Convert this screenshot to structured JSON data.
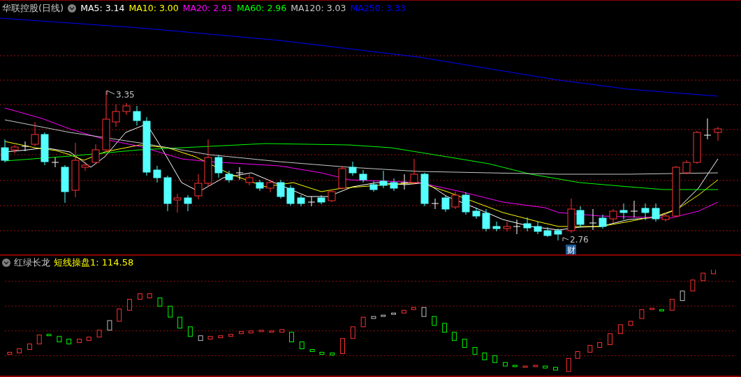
{
  "main_chart": {
    "title": "华联控股(日线)",
    "moving_averages": [
      {
        "label": "MA5: 3.14",
        "color": "#ffffff"
      },
      {
        "label": "MA10: 3.00",
        "color": "#ffff00"
      },
      {
        "label": "MA20: 2.91",
        "color": "#ff00ff"
      },
      {
        "label": "MA60: 2.96",
        "color": "#00ff00"
      },
      {
        "label": "MA120: 3.03",
        "color": "#c8c8c8"
      },
      {
        "label": "MA250: 3.33",
        "color": "#0000ff"
      }
    ],
    "high_label": "3.35",
    "low_label": "2.76",
    "event_marker": "财"
  },
  "indicator": {
    "title": "红绿长龙",
    "reading": "短线操盘1: 114.58"
  }
}
